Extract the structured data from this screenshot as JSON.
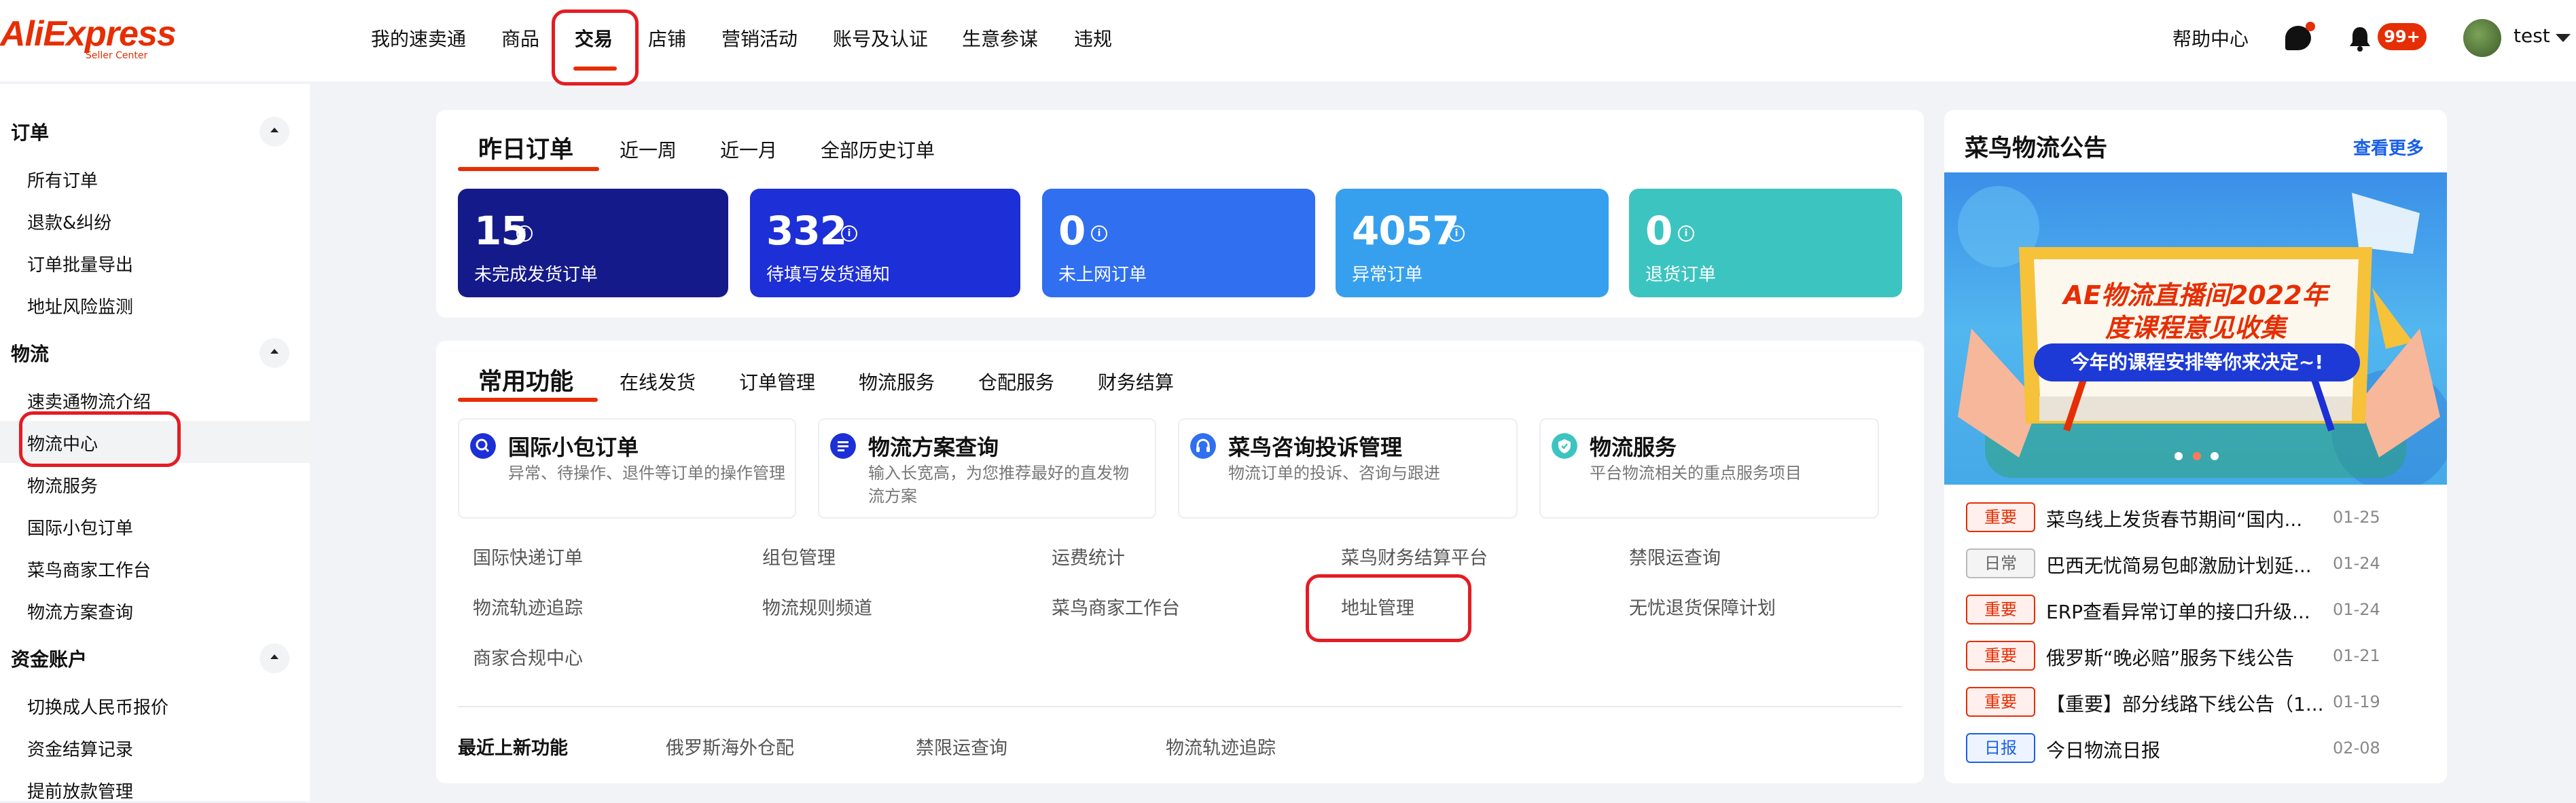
{
  "header": {
    "logo_text": "AliExpress",
    "logo_sub": "Seller Center",
    "nav": [
      "我的速卖通",
      "商品",
      "交易",
      "店铺",
      "营销活动",
      "账号及认证",
      "生意参谋",
      "违规"
    ],
    "active_nav": "交易",
    "help": "帮助中心",
    "notification_count": "99+",
    "user": "test"
  },
  "sidebar": {
    "sections": [
      {
        "title": "订单",
        "items": [
          "所有订单",
          "退款&纠纷",
          "订单批量导出",
          "地址风险监测"
        ]
      },
      {
        "title": "物流",
        "items": [
          "速卖通物流介绍",
          "物流中心",
          "物流服务",
          "国际小包订单",
          "菜鸟商家工作台",
          "物流方案查询"
        ]
      },
      {
        "title": "资金账户",
        "items": [
          "切换成人民币报价",
          "资金结算记录",
          "提前放款管理"
        ]
      }
    ],
    "active_item": "物流中心"
  },
  "orders": {
    "tabs": [
      "昨日订单",
      "近一周",
      "近一月",
      "全部历史订单"
    ],
    "stats": [
      {
        "value": "15",
        "label": "未完成发货订单",
        "color": "#151a8a"
      },
      {
        "value": "332",
        "label": "待填写发货通知",
        "color": "#1d2fd6"
      },
      {
        "value": "0",
        "label": "未上网订单",
        "color": "#2f6ff0"
      },
      {
        "value": "4057",
        "label": "异常订单",
        "color": "#36a0ee"
      },
      {
        "value": "0",
        "label": "退货订单",
        "color": "#3cc4c0"
      }
    ]
  },
  "functions": {
    "tabs": [
      "常用功能",
      "在线发货",
      "订单管理",
      "物流服务",
      "仓配服务",
      "财务结算"
    ],
    "cards": [
      {
        "title": "国际小包订单",
        "desc": "异常、待操作、退件等订单的操作管理",
        "icon": "search-icon",
        "color": "#1d2fd6"
      },
      {
        "title": "物流方案查询",
        "desc": "输入长宽高，为您推荐最好的直发物流方案",
        "icon": "list-icon",
        "color": "#1d2fd6"
      },
      {
        "title": "菜鸟咨询投诉管理",
        "desc": "物流订单的投诉、咨询与跟进",
        "icon": "headset-icon",
        "color": "#2f6ff0"
      },
      {
        "title": "物流服务",
        "desc": "平台物流相关的重点服务项目",
        "icon": "shield-icon",
        "color": "#3cc4c0"
      }
    ],
    "links": [
      [
        "国际快递订单",
        "组包管理",
        "运费统计",
        "菜鸟财务结算平台",
        "禁限运查询"
      ],
      [
        "物流轨迹追踪",
        "物流规则频道",
        "菜鸟商家工作台",
        "地址管理",
        "无忧退货保障计划"
      ],
      [
        "商家合规中心"
      ]
    ],
    "recent_label": "最近上新功能",
    "recent": [
      "俄罗斯海外仓配",
      "禁限运查询",
      "物流轨迹追踪"
    ]
  },
  "announcements": {
    "title": "菜鸟物流公告",
    "more": "查看更多",
    "banner_title_line1": "AE物流直播间2022年",
    "banner_title_line2": "度课程意见收集",
    "banner_subtitle": "今年的课程安排等你来决定~!",
    "items": [
      {
        "tag": "重要",
        "tag_type": "red",
        "text": "菜鸟线上发货春节期间“国内...",
        "date": "01-25"
      },
      {
        "tag": "日常",
        "tag_type": "gray",
        "text": "巴西无忧简易包邮激励计划延...",
        "date": "01-24"
      },
      {
        "tag": "重要",
        "tag_type": "red",
        "text": "ERP查看异常订单的接口升级...",
        "date": "01-24"
      },
      {
        "tag": "重要",
        "tag_type": "red",
        "text": "俄罗斯“晚必赔”服务下线公告",
        "date": "01-21"
      },
      {
        "tag": "重要",
        "tag_type": "red",
        "text": "【重要】部分线路下线公告（1...",
        "date": "01-19"
      },
      {
        "tag": "日报",
        "tag_type": "blue",
        "text": "今日物流日报",
        "date": "02-08"
      }
    ]
  },
  "colors": {
    "accent": "#e62e04",
    "highlight": "#e41c23"
  }
}
